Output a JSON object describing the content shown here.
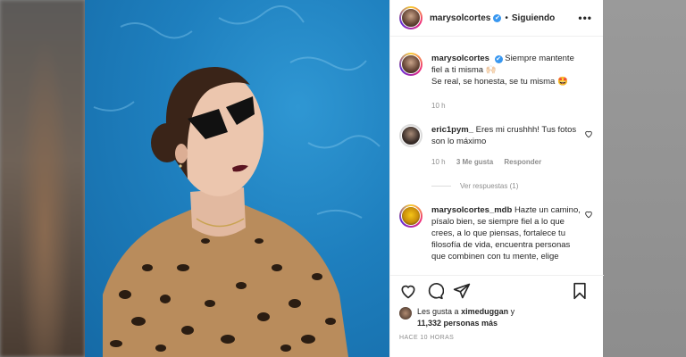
{
  "post": {
    "username": "marysolcortes",
    "verified_badge": "✔",
    "separator": "•",
    "follow_status": "Siguiendo",
    "more_label": "•••"
  },
  "comments": [
    {
      "username": "marysolcortes",
      "text_line1": "Siempre mantente fiel a ti misma 🙌🏻",
      "text_line2": "Se real, se honesta, se tu misma 🤩",
      "time": "10 h"
    },
    {
      "username": "eric1pym_",
      "text": "Eres mi crushhh! Tus fotos son lo máximo",
      "time": "10 h",
      "likes": "3 Me gusta",
      "reply": "Responder",
      "view_replies": "Ver respuestas (1)"
    },
    {
      "username": "marysolcortes_mdb",
      "text": "Hazte un camino, písalo bien, se siempre fiel a lo que crees, a lo que piensas, fortalece tu filosofía de vida, encuentra personas que combinen con tu mente, elige"
    }
  ],
  "likes": {
    "prefix": "Les gusta a",
    "user": "ximeduggan",
    "conj": "y",
    "count": "11,332 personas más"
  },
  "timestamp": "HACE 10 HORAS",
  "colors": {
    "link": "#3897f0",
    "muted": "#8e8e8e",
    "text": "#262626"
  },
  "icons": [
    "heart-icon",
    "comment-icon",
    "share-icon",
    "bookmark-icon",
    "more-icon",
    "verified-icon"
  ]
}
